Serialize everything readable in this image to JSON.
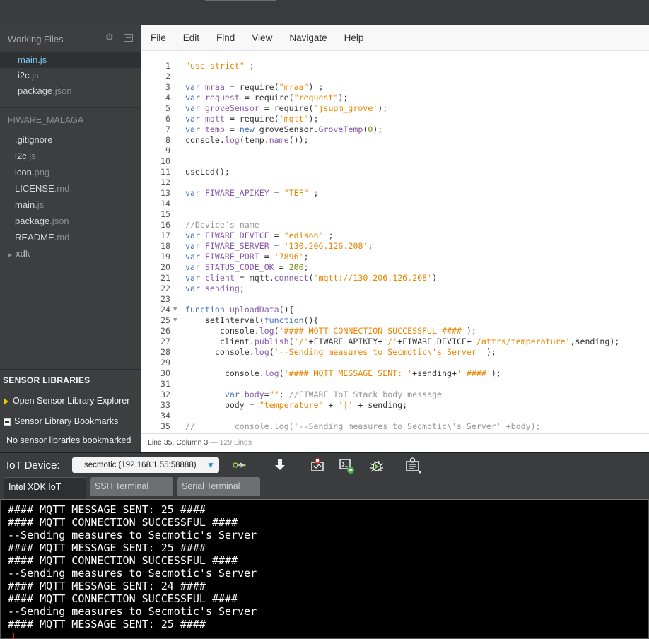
{
  "sidebar": {
    "working_files_label": "Working Files",
    "working_files": [
      {
        "base": "main",
        "ext": ".js",
        "active": true
      },
      {
        "base": "i2c",
        "ext": ".js",
        "active": false
      },
      {
        "base": "package",
        "ext": ".json",
        "active": false
      }
    ],
    "project_name": "FIWARE_MALAGA",
    "tree": [
      {
        "base": ".gitignore",
        "ext": ""
      },
      {
        "base": "i2c",
        "ext": ".js"
      },
      {
        "base": "icon",
        "ext": ".png"
      },
      {
        "base": "LICENSE",
        "ext": ".md"
      },
      {
        "base": "main",
        "ext": ".js"
      },
      {
        "base": "package",
        "ext": ".json"
      },
      {
        "base": "README",
        "ext": ".md"
      }
    ],
    "folder": "xdk",
    "sensor": {
      "title": "SENSOR LIBRARIES",
      "open_explorer": "Open Sensor Library Explorer",
      "bookmarks": "Sensor Library Bookmarks",
      "empty": "No sensor libraries bookmarked"
    }
  },
  "menu": [
    "File",
    "Edit",
    "Find",
    "View",
    "Navigate",
    "Help"
  ],
  "code": [
    {
      "n": "1",
      "h": "<span class='s'>\"use strict\"</span> ;"
    },
    {
      "n": "2",
      "h": ""
    },
    {
      "n": "3",
      "h": "<span class='k'>var</span> <span class='p'>mraa</span> = require(<span class='s'>\"mraa\"</span>) ;"
    },
    {
      "n": "4",
      "h": "<span class='k'>var</span> <span class='p'>request</span> = require(<span class='s'>\"request\"</span>);"
    },
    {
      "n": "5",
      "h": "<span class='k'>var</span> <span class='p'>groveSensor</span> = require(<span class='s'>'jsupm_grove'</span>);"
    },
    {
      "n": "6",
      "h": "<span class='k'>var</span> <span class='p'>mqtt</span> = require(<span class='s'>'mqtt'</span>);"
    },
    {
      "n": "7",
      "h": "<span class='k'>var</span> <span class='p'>temp</span> = <span class='k'>new</span> groveSensor.<span class='p'>GroveTemp</span>(<span class='n'>0</span>);"
    },
    {
      "n": "8",
      "h": "console.<span class='p'>log</span>(temp.<span class='p'>name</span>());"
    },
    {
      "n": "9",
      "h": ""
    },
    {
      "n": "10",
      "h": ""
    },
    {
      "n": "11",
      "h": "useLcd();"
    },
    {
      "n": "12",
      "h": ""
    },
    {
      "n": "13",
      "h": "<span class='k'>var</span> <span class='p'>FIWARE_APIKEY</span> = <span class='s'>\"TEF\"</span> ;"
    },
    {
      "n": "14",
      "h": ""
    },
    {
      "n": "15",
      "h": ""
    },
    {
      "n": "16",
      "h": "<span class='c'>//Device´s name</span>"
    },
    {
      "n": "17",
      "h": "<span class='k'>var</span> <span class='p'>FIWARE_DEVICE</span> = <span class='s'>\"edison\"</span> ;"
    },
    {
      "n": "18",
      "h": "<span class='k'>var</span> <span class='p'>FIWARE_SERVER</span> = <span class='s'>'130.206.126.208'</span>;"
    },
    {
      "n": "19",
      "h": "<span class='k'>var</span> <span class='p'>FIWARE_PORT</span> = <span class='s'>'7896'</span>;"
    },
    {
      "n": "20",
      "h": "<span class='k'>var</span> <span class='p'>STATUS_CODE_OK</span> = <span class='n'>200</span>;"
    },
    {
      "n": "21",
      "h": "<span class='k'>var</span> <span class='p'>client</span> = mqtt.<span class='p'>connect</span>(<span class='s'>'mqtt://130.206.126.208'</span>)"
    },
    {
      "n": "22",
      "h": "<span class='k'>var</span> <span class='p'>sending</span>;"
    },
    {
      "n": "23",
      "h": ""
    },
    {
      "n": "24",
      "fold": true,
      "h": "<span class='k'>function</span> <span class='p'>uploadData</span>(){"
    },
    {
      "n": "25",
      "fold": true,
      "h": "    setInterval(<span class='k'>function</span>(){"
    },
    {
      "n": "26",
      "h": "       console.<span class='p'>log</span>(<span class='s'>'#### MQTT CONNECTION SUCCESSFUL ####'</span>);"
    },
    {
      "n": "27",
      "h": "       client.<span class='p'>publish</span>(<span class='s'>'/'</span>+FIWARE_APIKEY+<span class='s'>'/'</span>+FIWARE_DEVICE+<span class='s'>'/attrs/temperature'</span>,sending);"
    },
    {
      "n": "28",
      "h": "      console.<span class='p'>log</span>(<span class='s'>'--Sending measures to Secmotic\\'s Server'</span> );"
    },
    {
      "n": "29",
      "h": ""
    },
    {
      "n": "30",
      "h": "        console.<span class='p'>log</span>(<span class='s'>'#### MQTT MESSAGE SENT: '</span>+sending+<span class='s'>' ####'</span>);"
    },
    {
      "n": "31",
      "h": ""
    },
    {
      "n": "32",
      "h": "        <span class='k'>var</span> <span class='p'>body</span>=<span class='s'>\"\"</span>; <span class='c'>//FIWARE IoT Stack body message</span>"
    },
    {
      "n": "33",
      "h": "        body = <span class='s'>\"temperature\"</span> + <span class='s'>'|'</span> + sending;"
    },
    {
      "n": "34",
      "h": ""
    },
    {
      "n": "35",
      "h": "<span class='c'>//        console.log('--Sending measures to Secmotic\\'s Server' +body);</span>"
    }
  ],
  "status": {
    "position": "Line 35, Column 3",
    "lines": " — 129 Lines"
  },
  "iot": {
    "label": "IoT Device:",
    "device": "secmotic (192.168.1.55:58888)",
    "tabs": [
      "Intel XDK IoT",
      "SSH Terminal",
      "Serial Terminal"
    ]
  },
  "terminal": [
    "#### MQTT MESSAGE SENT: 25 ####",
    "#### MQTT CONNECTION SUCCESSFUL ####",
    "--Sending measures to Secmotic's Server",
    "#### MQTT MESSAGE SENT: 25 ####",
    "#### MQTT CONNECTION SUCCESSFUL ####",
    "--Sending measures to Secmotic's Server",
    "#### MQTT MESSAGE SENT: 24 ####",
    "#### MQTT CONNECTION SUCCESSFUL ####",
    "--Sending measures to Secmotic's Server",
    "#### MQTT MESSAGE SENT: 25 ####"
  ]
}
